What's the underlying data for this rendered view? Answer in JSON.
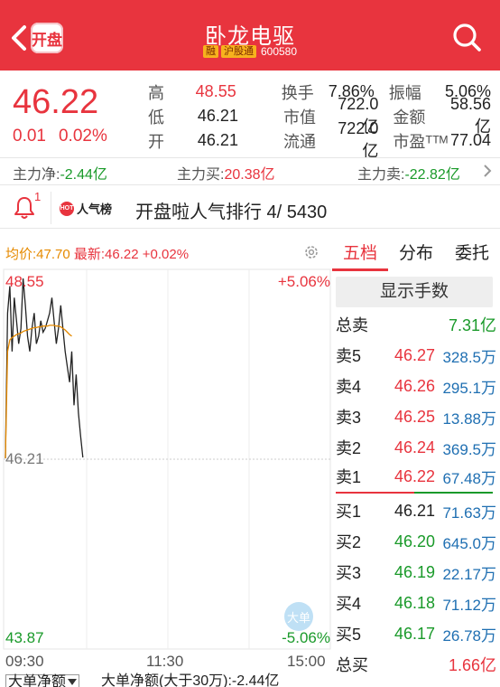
{
  "header": {
    "back_label": "开盘",
    "title": "卧龙电驱",
    "tags": [
      "融",
      "沪股通"
    ],
    "code": "600580"
  },
  "quote": {
    "price": "46.22",
    "change": "0.01",
    "change_pct": "0.02%",
    "stats": [
      {
        "l1": "高",
        "v1": "48.55",
        "l2": "换手",
        "v2": "7.86%",
        "l3": "振幅",
        "v3": "5.06%"
      },
      {
        "l1": "低",
        "v1": "46.21",
        "l2": "市值",
        "v2": "722.0亿",
        "l3": "金额",
        "v3": "58.56亿"
      },
      {
        "l1": "开",
        "v1": "46.21",
        "l2": "流通",
        "v2": "722.0亿",
        "l3": "市盈ᵀᵀᴹ",
        "v3": "77.04"
      }
    ]
  },
  "flow": {
    "net_label": "主力净:",
    "net_value": "-2.44亿",
    "buy_label": "主力买:",
    "buy_value": "20.38亿",
    "sell_label": "主力卖:",
    "sell_value": "-22.82亿"
  },
  "popularity": {
    "badge_count": "1",
    "logo_hot": "HOT",
    "logo_text": "人气榜",
    "text": "开盘啦人气排行 4/ 5430"
  },
  "chart_head": {
    "avg": "均价:47.70",
    "latest": "最新:46.22 +0.02%"
  },
  "chart_labels": {
    "y_high": "48.55",
    "y_mid": "46.21",
    "y_low": "43.87",
    "pct_high": "+5.06%",
    "pct_low": "-5.06%",
    "bubble": "大单",
    "x_ticks": [
      "09:30",
      "11:30",
      "15:00"
    ]
  },
  "chart_data": {
    "type": "line",
    "ylim": [
      43.87,
      48.55
    ],
    "x_ticks": [
      "09:30",
      "11:30",
      "15:00"
    ],
    "series": [
      {
        "values": [
          46.21,
          48.1,
          48.45,
          47.6,
          48.3,
          48.0,
          47.7,
          47.9,
          48.55,
          48.2,
          47.8,
          47.6,
          47.9,
          48.1,
          47.7,
          47.8,
          48.0,
          47.85,
          47.9,
          48.0,
          48.1,
          48.3,
          48.0,
          47.7,
          47.9,
          48.2,
          47.9,
          47.6,
          47.4,
          47.2,
          47.6,
          46.9,
          47.3,
          46.8,
          46.5,
          46.22
        ]
      },
      {
        "values": [
          46.21,
          47.6,
          47.75,
          47.78,
          47.8,
          47.82,
          47.83,
          47.84,
          47.86,
          47.87,
          47.88,
          47.89,
          47.9,
          47.91,
          47.91,
          47.92,
          47.92,
          47.93,
          47.93,
          47.93,
          47.94,
          47.94,
          47.94,
          47.93,
          47.93,
          47.92,
          47.9,
          47.88,
          47.85,
          47.82,
          47.8
        ]
      }
    ]
  },
  "footer": {
    "select_label": "大单净额",
    "text": "大单净额(大于30万):-2.44亿"
  },
  "order_book": {
    "tabs": [
      "五档",
      "分布",
      "委托"
    ],
    "show_hands": "显示手数",
    "total_sell_label": "总卖",
    "total_sell": "7.31亿",
    "sells": [
      {
        "label": "卖5",
        "price": "46.27",
        "vol": "328.5万"
      },
      {
        "label": "卖4",
        "price": "46.26",
        "vol": "295.1万"
      },
      {
        "label": "卖3",
        "price": "46.25",
        "vol": "13.88万"
      },
      {
        "label": "卖2",
        "price": "46.24",
        "vol": "369.5万"
      },
      {
        "label": "卖1",
        "price": "46.22",
        "vol": "67.48万"
      }
    ],
    "buys": [
      {
        "label": "买1",
        "price": "46.21",
        "vol": "71.63万"
      },
      {
        "label": "买2",
        "price": "46.20",
        "vol": "645.0万"
      },
      {
        "label": "买3",
        "price": "46.19",
        "vol": "22.17万"
      },
      {
        "label": "买4",
        "price": "46.18",
        "vol": "71.12万"
      },
      {
        "label": "买5",
        "price": "46.17",
        "vol": "26.78万"
      }
    ],
    "total_buy_label": "总买",
    "total_buy": "1.66亿"
  },
  "colors": {
    "up": "#e8343e",
    "down": "#1a9a2a",
    "avg_line": "#e68a00",
    "volume": "#1f6fb2"
  }
}
